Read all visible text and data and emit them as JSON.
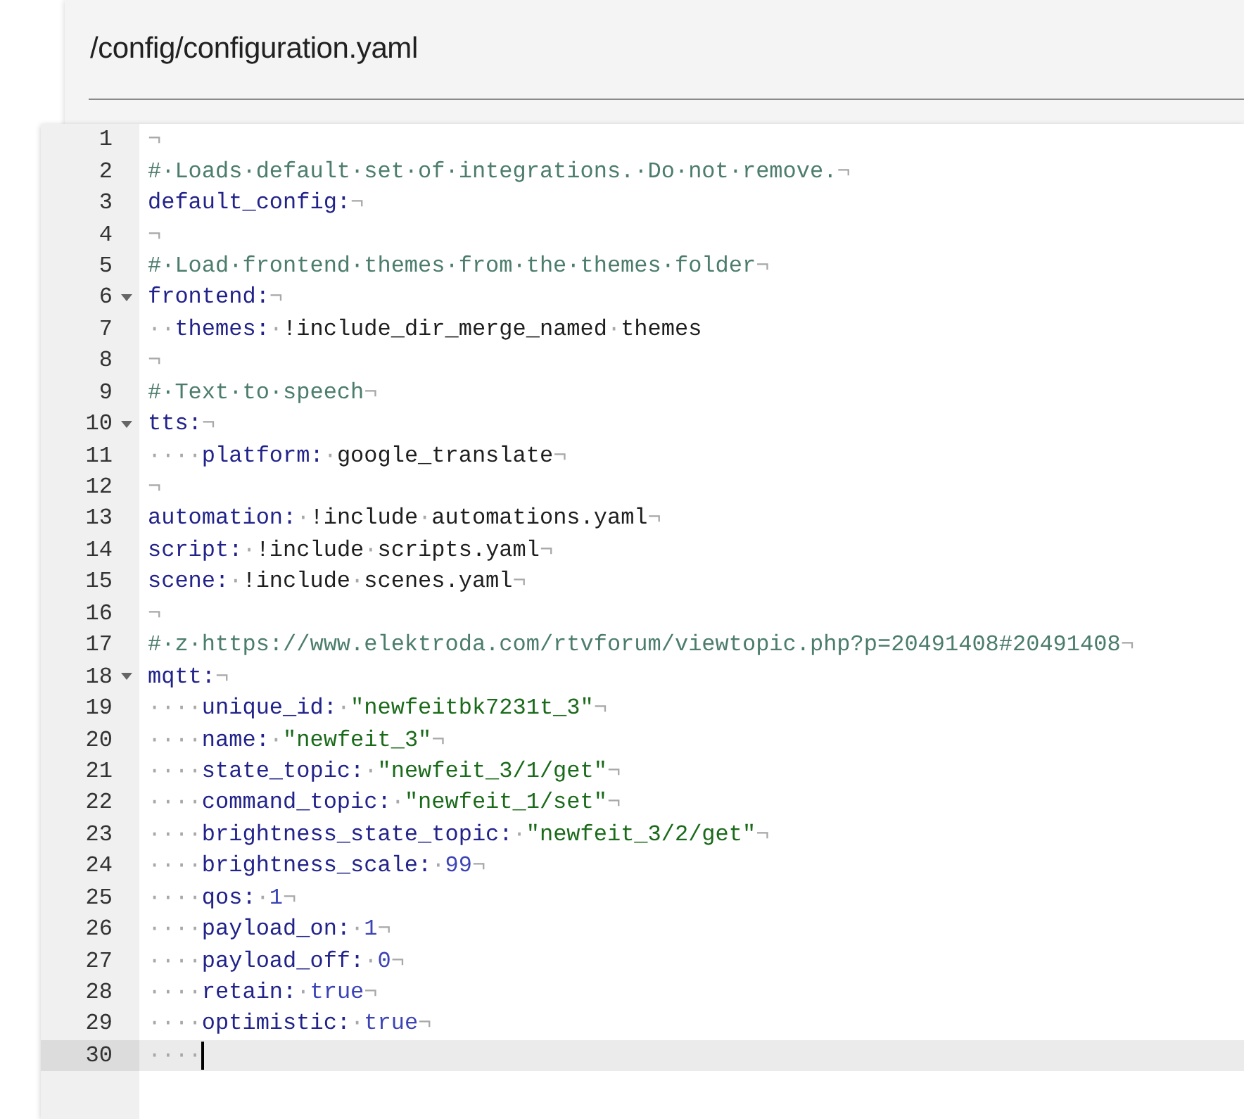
{
  "file_title": "/config/configuration.yaml",
  "lines": [
    {
      "number": "1",
      "fold": false,
      "current": false,
      "tokens": [
        {
          "kind": "eol",
          "text": "¬"
        }
      ]
    },
    {
      "number": "2",
      "fold": false,
      "current": false,
      "tokens": [
        {
          "kind": "comment",
          "text": "#·Loads·default·set·of·integrations.·Do·not·remove."
        },
        {
          "kind": "eol",
          "text": "¬"
        }
      ]
    },
    {
      "number": "3",
      "fold": false,
      "current": false,
      "tokens": [
        {
          "kind": "key",
          "text": "default_config:"
        },
        {
          "kind": "eol",
          "text": "¬"
        }
      ]
    },
    {
      "number": "4",
      "fold": false,
      "current": false,
      "tokens": [
        {
          "kind": "eol",
          "text": "¬"
        }
      ]
    },
    {
      "number": "5",
      "fold": false,
      "current": false,
      "tokens": [
        {
          "kind": "comment",
          "text": "#·Load·frontend·themes·from·the·themes·folder"
        },
        {
          "kind": "eol",
          "text": "¬"
        }
      ]
    },
    {
      "number": "6",
      "fold": true,
      "expanded": true,
      "current": false,
      "tokens": [
        {
          "kind": "key",
          "text": "frontend:"
        },
        {
          "kind": "eol",
          "text": "¬"
        }
      ]
    },
    {
      "number": "7",
      "fold": false,
      "current": false,
      "tokens": [
        {
          "kind": "ws",
          "text": "··"
        },
        {
          "kind": "key",
          "text": "themes:"
        },
        {
          "kind": "ws",
          "text": "·"
        },
        {
          "kind": "plain",
          "text": "!include_dir_merge_named"
        },
        {
          "kind": "ws",
          "text": "·"
        },
        {
          "kind": "plain",
          "text": "themes"
        }
      ]
    },
    {
      "number": "8",
      "fold": false,
      "current": false,
      "tokens": [
        {
          "kind": "eol",
          "text": "¬"
        }
      ]
    },
    {
      "number": "9",
      "fold": false,
      "current": false,
      "tokens": [
        {
          "kind": "comment",
          "text": "#·Text·to·speech"
        },
        {
          "kind": "eol",
          "text": "¬"
        }
      ]
    },
    {
      "number": "10",
      "fold": true,
      "expanded": true,
      "current": false,
      "tokens": [
        {
          "kind": "key",
          "text": "tts:"
        },
        {
          "kind": "eol",
          "text": "¬"
        }
      ]
    },
    {
      "number": "11",
      "fold": false,
      "current": false,
      "tokens": [
        {
          "kind": "ws",
          "text": "····"
        },
        {
          "kind": "key",
          "text": "platform:"
        },
        {
          "kind": "ws",
          "text": "·"
        },
        {
          "kind": "plain",
          "text": "google_translate"
        },
        {
          "kind": "eol",
          "text": "¬"
        }
      ]
    },
    {
      "number": "12",
      "fold": false,
      "current": false,
      "tokens": [
        {
          "kind": "eol",
          "text": "¬"
        }
      ]
    },
    {
      "number": "13",
      "fold": false,
      "current": false,
      "tokens": [
        {
          "kind": "key",
          "text": "automation:"
        },
        {
          "kind": "ws",
          "text": "·"
        },
        {
          "kind": "plain",
          "text": "!include"
        },
        {
          "kind": "ws",
          "text": "·"
        },
        {
          "kind": "plain",
          "text": "automations.yaml"
        },
        {
          "kind": "eol",
          "text": "¬"
        }
      ]
    },
    {
      "number": "14",
      "fold": false,
      "current": false,
      "tokens": [
        {
          "kind": "key",
          "text": "script:"
        },
        {
          "kind": "ws",
          "text": "·"
        },
        {
          "kind": "plain",
          "text": "!include"
        },
        {
          "kind": "ws",
          "text": "·"
        },
        {
          "kind": "plain",
          "text": "scripts.yaml"
        },
        {
          "kind": "eol",
          "text": "¬"
        }
      ]
    },
    {
      "number": "15",
      "fold": false,
      "current": false,
      "tokens": [
        {
          "kind": "key",
          "text": "scene:"
        },
        {
          "kind": "ws",
          "text": "·"
        },
        {
          "kind": "plain",
          "text": "!include"
        },
        {
          "kind": "ws",
          "text": "·"
        },
        {
          "kind": "plain",
          "text": "scenes.yaml"
        },
        {
          "kind": "eol",
          "text": "¬"
        }
      ]
    },
    {
      "number": "16",
      "fold": false,
      "current": false,
      "tokens": [
        {
          "kind": "eol",
          "text": "¬"
        }
      ]
    },
    {
      "number": "17",
      "fold": false,
      "current": false,
      "tokens": [
        {
          "kind": "comment",
          "text": "#·z·https://www.elektroda.com/rtvforum/viewtopic.php?p=20491408#20491408"
        },
        {
          "kind": "eol",
          "text": "¬"
        }
      ]
    },
    {
      "number": "18",
      "fold": true,
      "expanded": true,
      "current": false,
      "tokens": [
        {
          "kind": "key",
          "text": "mqtt:"
        },
        {
          "kind": "eol",
          "text": "¬"
        }
      ]
    },
    {
      "number": "19",
      "fold": false,
      "current": false,
      "tokens": [
        {
          "kind": "ws",
          "text": "····"
        },
        {
          "kind": "key",
          "text": "unique_id:"
        },
        {
          "kind": "ws",
          "text": "·"
        },
        {
          "kind": "string",
          "text": "\"newfeitbk7231t_3\""
        },
        {
          "kind": "eol",
          "text": "¬"
        }
      ]
    },
    {
      "number": "20",
      "fold": false,
      "current": false,
      "tokens": [
        {
          "kind": "ws",
          "text": "····"
        },
        {
          "kind": "key",
          "text": "name:"
        },
        {
          "kind": "ws",
          "text": "·"
        },
        {
          "kind": "string",
          "text": "\"newfeit_3\""
        },
        {
          "kind": "eol",
          "text": "¬"
        }
      ]
    },
    {
      "number": "21",
      "fold": false,
      "current": false,
      "tokens": [
        {
          "kind": "ws",
          "text": "····"
        },
        {
          "kind": "key",
          "text": "state_topic:"
        },
        {
          "kind": "ws",
          "text": "·"
        },
        {
          "kind": "string",
          "text": "\"newfeit_3/1/get\""
        },
        {
          "kind": "eol",
          "text": "¬"
        }
      ]
    },
    {
      "number": "22",
      "fold": false,
      "current": false,
      "tokens": [
        {
          "kind": "ws",
          "text": "····"
        },
        {
          "kind": "key",
          "text": "command_topic:"
        },
        {
          "kind": "ws",
          "text": "·"
        },
        {
          "kind": "string",
          "text": "\"newfeit_1/set\""
        },
        {
          "kind": "eol",
          "text": "¬"
        }
      ]
    },
    {
      "number": "23",
      "fold": false,
      "current": false,
      "tokens": [
        {
          "kind": "ws",
          "text": "····"
        },
        {
          "kind": "key",
          "text": "brightness_state_topic:"
        },
        {
          "kind": "ws",
          "text": "·"
        },
        {
          "kind": "string",
          "text": "\"newfeit_3/2/get\""
        },
        {
          "kind": "eol",
          "text": "¬"
        }
      ]
    },
    {
      "number": "24",
      "fold": false,
      "current": false,
      "tokens": [
        {
          "kind": "ws",
          "text": "····"
        },
        {
          "kind": "key",
          "text": "brightness_scale:"
        },
        {
          "kind": "ws",
          "text": "·"
        },
        {
          "kind": "number",
          "text": "99"
        },
        {
          "kind": "eol",
          "text": "¬"
        }
      ]
    },
    {
      "number": "25",
      "fold": false,
      "current": false,
      "tokens": [
        {
          "kind": "ws",
          "text": "····"
        },
        {
          "kind": "key",
          "text": "qos:"
        },
        {
          "kind": "ws",
          "text": "·"
        },
        {
          "kind": "number",
          "text": "1"
        },
        {
          "kind": "eol",
          "text": "¬"
        }
      ]
    },
    {
      "number": "26",
      "fold": false,
      "current": false,
      "tokens": [
        {
          "kind": "ws",
          "text": "····"
        },
        {
          "kind": "key",
          "text": "payload_on:"
        },
        {
          "kind": "ws",
          "text": "·"
        },
        {
          "kind": "number",
          "text": "1"
        },
        {
          "kind": "eol",
          "text": "¬"
        }
      ]
    },
    {
      "number": "27",
      "fold": false,
      "current": false,
      "tokens": [
        {
          "kind": "ws",
          "text": "····"
        },
        {
          "kind": "key",
          "text": "payload_off:"
        },
        {
          "kind": "ws",
          "text": "·"
        },
        {
          "kind": "number",
          "text": "0"
        },
        {
          "kind": "eol",
          "text": "¬"
        }
      ]
    },
    {
      "number": "28",
      "fold": false,
      "current": false,
      "tokens": [
        {
          "kind": "ws",
          "text": "····"
        },
        {
          "kind": "key",
          "text": "retain:"
        },
        {
          "kind": "ws",
          "text": "·"
        },
        {
          "kind": "bool",
          "text": "true"
        },
        {
          "kind": "eol",
          "text": "¬"
        }
      ]
    },
    {
      "number": "29",
      "fold": false,
      "current": false,
      "tokens": [
        {
          "kind": "ws",
          "text": "····"
        },
        {
          "kind": "key",
          "text": "optimistic:"
        },
        {
          "kind": "ws",
          "text": "·"
        },
        {
          "kind": "bool",
          "text": "true"
        },
        {
          "kind": "eol",
          "text": "¬"
        }
      ]
    },
    {
      "number": "30",
      "fold": false,
      "current": true,
      "cursor": true,
      "tokens": [
        {
          "kind": "ws",
          "text": "····"
        }
      ]
    }
  ]
}
